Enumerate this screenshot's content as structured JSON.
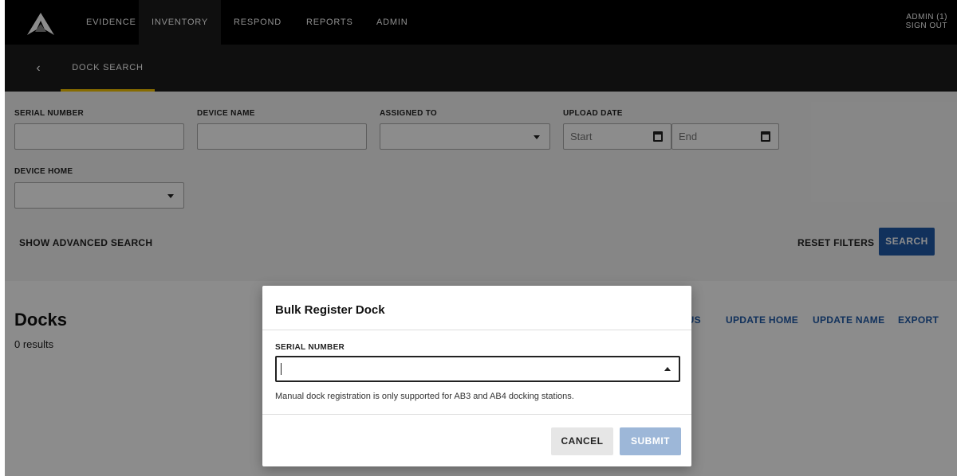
{
  "nav": {
    "items": [
      {
        "label": "EVIDENCE",
        "active": false
      },
      {
        "label": "INVENTORY",
        "active": true
      },
      {
        "label": "RESPOND",
        "active": false
      },
      {
        "label": "REPORTS",
        "active": false
      },
      {
        "label": "ADMIN",
        "active": false
      }
    ],
    "user_label": "ADMIN (1)",
    "sign_out": "SIGN OUT",
    "logo_icon": "brand-logo-icon"
  },
  "subnav": {
    "back_icon": "chevron-left-icon",
    "back_glyph": "‹",
    "tab_label": "DOCK SEARCH",
    "accent_color": "#f5c400"
  },
  "filters": {
    "serial_number_label": "SERIAL NUMBER",
    "serial_number_value": "",
    "device_name_label": "DEVICE NAME",
    "device_name_value": "",
    "assigned_to_label": "ASSIGNED TO",
    "assigned_to_value": "",
    "upload_date_label": "UPLOAD DATE",
    "upload_date_start_placeholder": "Start",
    "upload_date_end_placeholder": "End",
    "device_home_label": "DEVICE HOME",
    "device_home_value": "",
    "show_advanced": "SHOW ADVANCED SEARCH",
    "reset_filters": "RESET FILTERS",
    "search": "SEARCH"
  },
  "results": {
    "title": "Docks",
    "count": "0 results",
    "actions": [
      {
        "label": "TUS"
      },
      {
        "label": "UPDATE HOME"
      },
      {
        "label": "UPDATE NAME"
      },
      {
        "label": "EXPORT"
      }
    ]
  },
  "modal": {
    "title": "Bulk Register Dock",
    "field_label": "SERIAL NUMBER",
    "field_value": "",
    "help_text": "Manual dock registration is only supported for AB3 and AB4 docking stations.",
    "cancel": "CANCEL",
    "submit": "SUBMIT"
  },
  "colors": {
    "primary": "#1f5aa8",
    "nav_bg": "#000000",
    "subnav_bg": "#1c1c1c",
    "submit_disabled": "#9db7d8"
  }
}
